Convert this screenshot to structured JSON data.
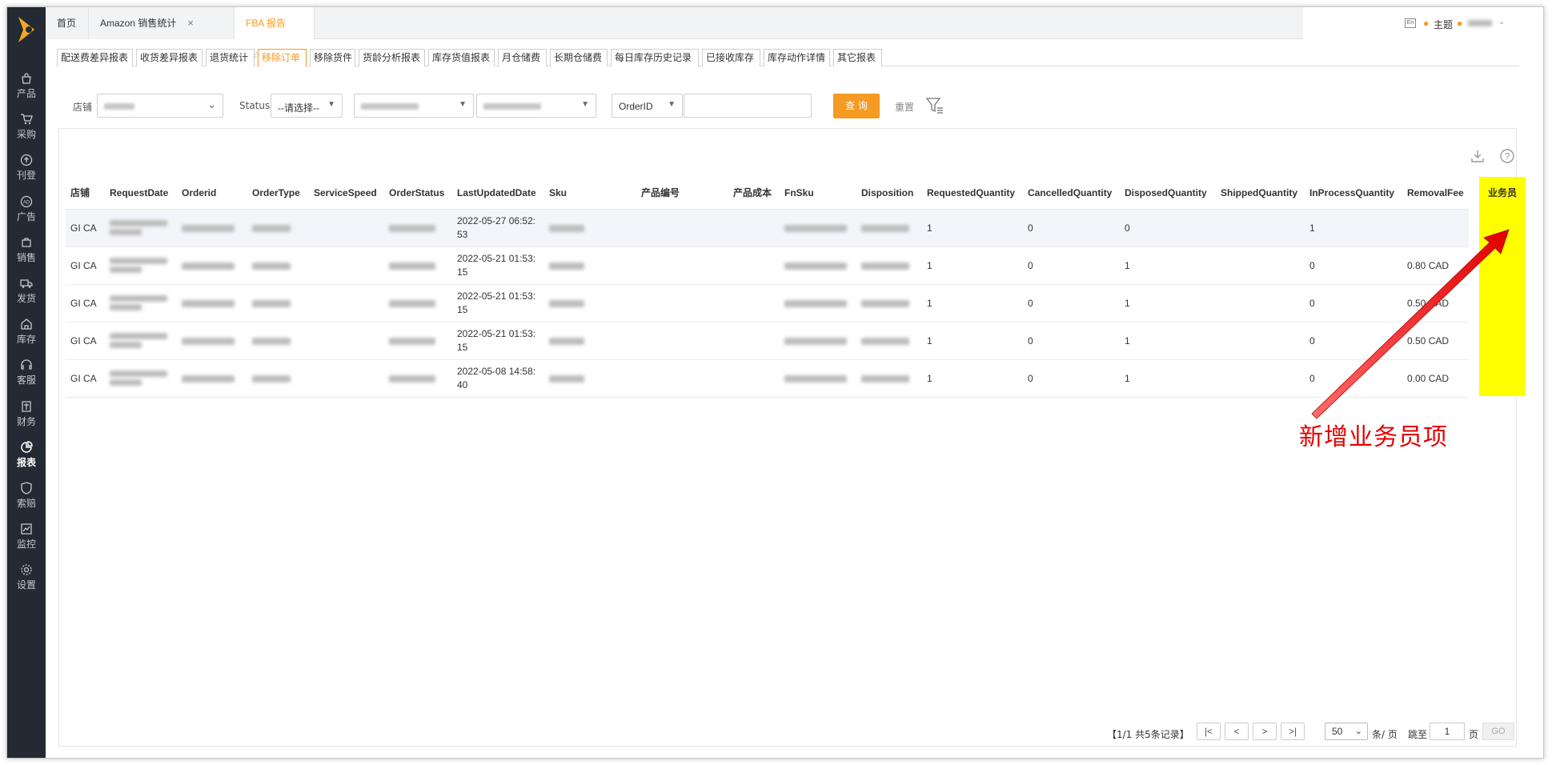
{
  "sidebar": {
    "items": [
      {
        "label": "产品",
        "icon": "bag-icon"
      },
      {
        "label": "采购",
        "icon": "cart-icon"
      },
      {
        "label": "刊登",
        "icon": "upload-icon"
      },
      {
        "label": "广告",
        "icon": "ad-icon"
      },
      {
        "label": "销售",
        "icon": "sales-icon"
      },
      {
        "label": "发货",
        "icon": "truck-icon"
      },
      {
        "label": "库存",
        "icon": "warehouse-icon"
      },
      {
        "label": "客服",
        "icon": "headset-icon"
      },
      {
        "label": "财务",
        "icon": "finance-icon"
      },
      {
        "label": "报表",
        "icon": "pie-chart-icon"
      },
      {
        "label": "索赔",
        "icon": "claim-icon"
      },
      {
        "label": "监控",
        "icon": "monitor-icon"
      },
      {
        "label": "设置",
        "icon": "gear-icon"
      }
    ]
  },
  "tabs": {
    "home": "首页",
    "amazon": "Amazon 销售统计",
    "fba": "FBA 报告",
    "close": "×",
    "star": "☆"
  },
  "topright": {
    "theme": "主题"
  },
  "subtabs": [
    "配送费差异报表",
    "收货差异报表",
    "退货统计",
    "移除订单",
    "移除货件",
    "货龄分析报表",
    "库存货值报表",
    "月仓储费",
    "长期仓储费",
    "每日库存历史记录",
    "已接收库存",
    "库存动作详情",
    "其它报表"
  ],
  "filters": {
    "store_label": "店铺",
    "status_label": "Status",
    "status_value": "--请选择--",
    "orderid_select": "OrderID",
    "query_button": "查 询",
    "reset_button": "重置"
  },
  "table": {
    "headers": [
      "店铺",
      "RequestDate",
      "Orderid",
      "OrderType",
      "ServiceSpeed",
      "OrderStatus",
      "LastUpdatedDate",
      "Sku",
      "产品编号",
      "产品成本",
      "FnSku",
      "Disposition",
      "RequestedQuantity",
      "CancelledQuantity",
      "DisposedQuantity",
      "ShippedQuantity",
      "InProcessQuantity",
      "RemovalFee"
    ],
    "salesman_header": "业务员",
    "rows": [
      {
        "store": "GI CA",
        "updated1": "2022-05-27 06:52:",
        "updated2": "53",
        "req": "1",
        "cancel": "0",
        "disposed": "0",
        "shipped": "",
        "inproc": "1",
        "fee": ""
      },
      {
        "store": "GI CA",
        "updated1": "2022-05-21 01:53:",
        "updated2": "15",
        "req": "1",
        "cancel": "0",
        "disposed": "1",
        "shipped": "",
        "inproc": "0",
        "fee": "0.80 CAD"
      },
      {
        "store": "GI CA",
        "updated1": "2022-05-21 01:53:",
        "updated2": "15",
        "req": "1",
        "cancel": "0",
        "disposed": "1",
        "shipped": "",
        "inproc": "0",
        "fee": "0.50 CAD"
      },
      {
        "store": "GI CA",
        "updated1": "2022-05-21 01:53:",
        "updated2": "15",
        "req": "1",
        "cancel": "0",
        "disposed": "1",
        "shipped": "",
        "inproc": "0",
        "fee": "0.50 CAD"
      },
      {
        "store": "GI CA",
        "updated1": "2022-05-08 14:58:",
        "updated2": "40",
        "req": "1",
        "cancel": "0",
        "disposed": "1",
        "shipped": "",
        "inproc": "0",
        "fee": "0.00 CAD"
      }
    ]
  },
  "annotation": "新增业务员项",
  "pager": {
    "summary": "【1/1   共5条记录】",
    "first": "|<",
    "prev": "<",
    "next": ">",
    "last": ">|",
    "page_size": "50",
    "per_page": "条/ 页",
    "jump": "跳至",
    "page_input": "1",
    "page_unit": "页",
    "go": "GO"
  },
  "colors": {
    "accent": "#f59a23",
    "sidebar": "#232a33",
    "highlight": "#ffff00",
    "annotation": "#e60000"
  }
}
